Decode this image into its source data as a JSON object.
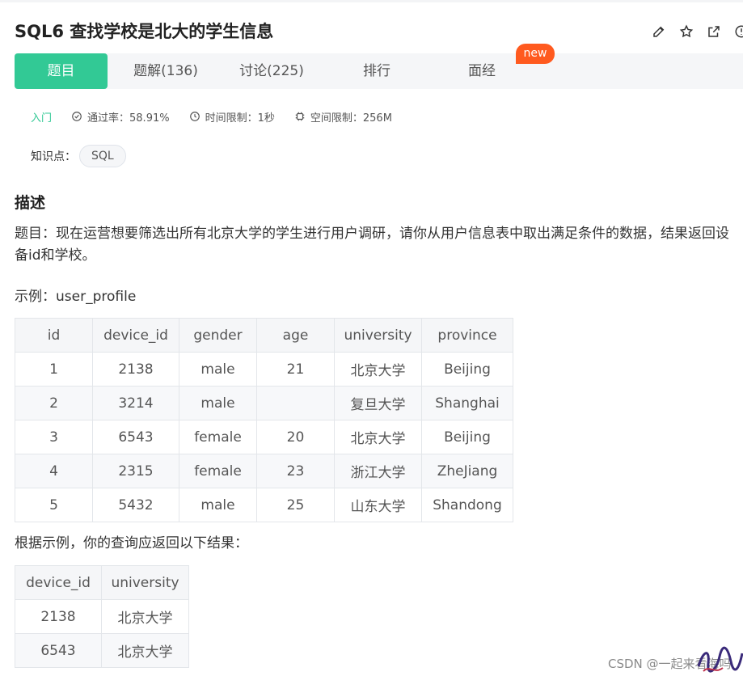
{
  "title": "SQL6  查找学校是北大的学生信息",
  "title_actions": [
    "edit-icon",
    "star-icon",
    "share-icon",
    "info-icon"
  ],
  "tabs": [
    {
      "label": "题目",
      "active": true
    },
    {
      "label": "题解(136)",
      "active": false
    },
    {
      "label": "讨论(225)",
      "active": false
    },
    {
      "label": "排行",
      "active": false
    },
    {
      "label": "面经",
      "active": false
    }
  ],
  "new_badge": "new",
  "meta": {
    "level": "入门",
    "pass_rate": "通过率：58.91%",
    "time_limit": "时间限制：1秒",
    "space_limit": "空间限制：256M"
  },
  "knowledge": {
    "label": "知识点：",
    "tag": "SQL"
  },
  "description": {
    "heading": "描述",
    "text": "题目：现在运营想要筛选出所有北京大学的学生进行用户调研，请你从用户信息表中取出满足条件的数据，结果返回设备id和学校。",
    "example_label": "示例：user_profile",
    "result_label": "根据示例，你的查询应返回以下结果："
  },
  "table1": {
    "headers": [
      "id",
      "device_id",
      "gender",
      "age",
      "university",
      "province"
    ],
    "rows": [
      [
        "1",
        "2138",
        "male",
        "21",
        "北京大学",
        "Beijing"
      ],
      [
        "2",
        "3214",
        "male",
        "",
        "复旦大学",
        "Shanghai"
      ],
      [
        "3",
        "6543",
        "female",
        "20",
        "北京大学",
        "Beijing"
      ],
      [
        "4",
        "2315",
        "female",
        "23",
        "浙江大学",
        "ZheJiang"
      ],
      [
        "5",
        "5432",
        "male",
        "25",
        "山东大学",
        "Shandong"
      ]
    ]
  },
  "table2": {
    "headers": [
      "device_id",
      "university"
    ],
    "rows": [
      [
        "2138",
        "北京大学"
      ],
      [
        "6543",
        "北京大学"
      ]
    ]
  },
  "watermark": "CSDN @一起来看海吗",
  "colors": {
    "accent": "#32c995",
    "badge": "#ff5a1f",
    "tab_bg": "#f5f6f8"
  }
}
